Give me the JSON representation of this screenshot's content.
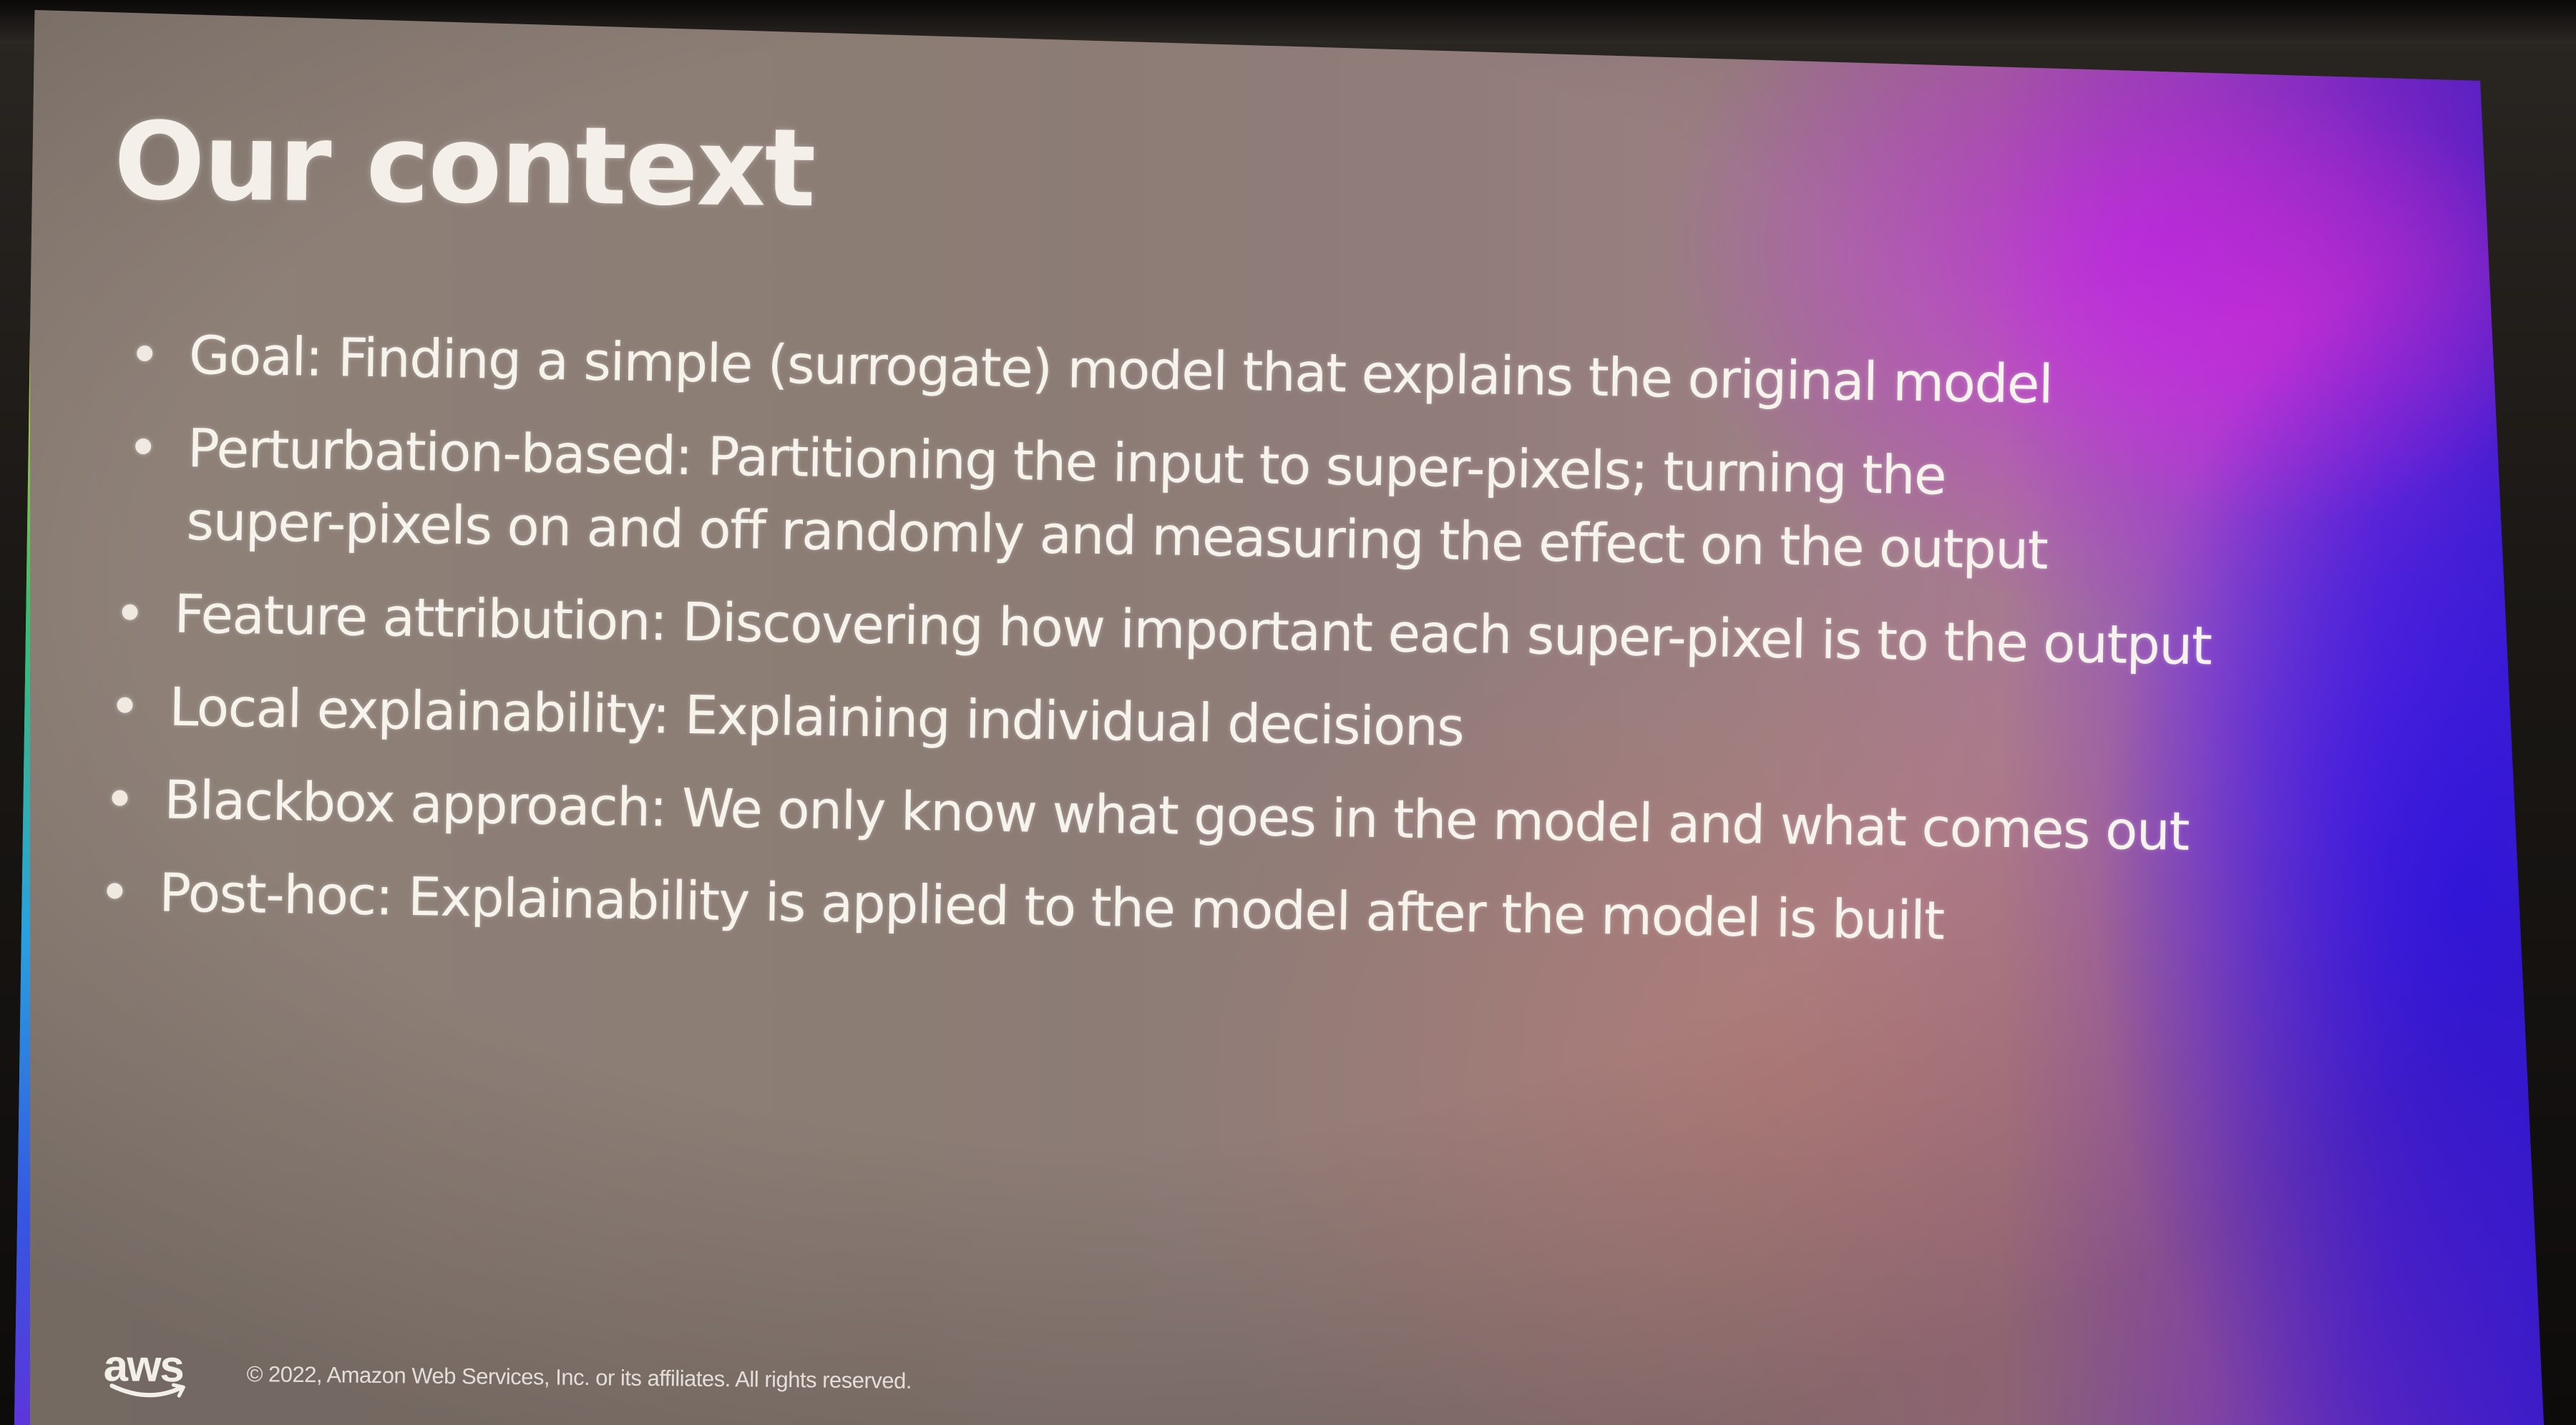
{
  "slide": {
    "title": "Our context",
    "bullets": [
      {
        "label": "Goal:",
        "text": "Finding a simple (surrogate) model that explains the original model"
      },
      {
        "label": "Perturbation-based:",
        "text": "Partitioning the input to super-pixels; turning the",
        "text2": "super-pixels on and off randomly and measuring the effect on the output"
      },
      {
        "label": "Feature attribution:",
        "text": "Discovering how important each super-pixel is to the output"
      },
      {
        "label": "Local explainability:",
        "text": "Explaining individual decisions"
      },
      {
        "label": "Blackbox approach:",
        "text": "We only know what goes in the model and what comes out"
      },
      {
        "label": "Post-hoc:",
        "text": "Explainability is applied to the model after the model is built"
      }
    ],
    "footer": {
      "logo_text": "aws",
      "copyright": "© 2022, Amazon Web Services, Inc. or its affiliates. All rights reserved."
    }
  },
  "colors": {
    "text": "#f6f2ec",
    "gradient_left": "#8e8178",
    "gradient_right": "#4a22f2",
    "accent_pink": "#c828f0"
  },
  "icons": {
    "logo": "aws-logo-icon",
    "bullet": "bullet-dot-icon"
  }
}
